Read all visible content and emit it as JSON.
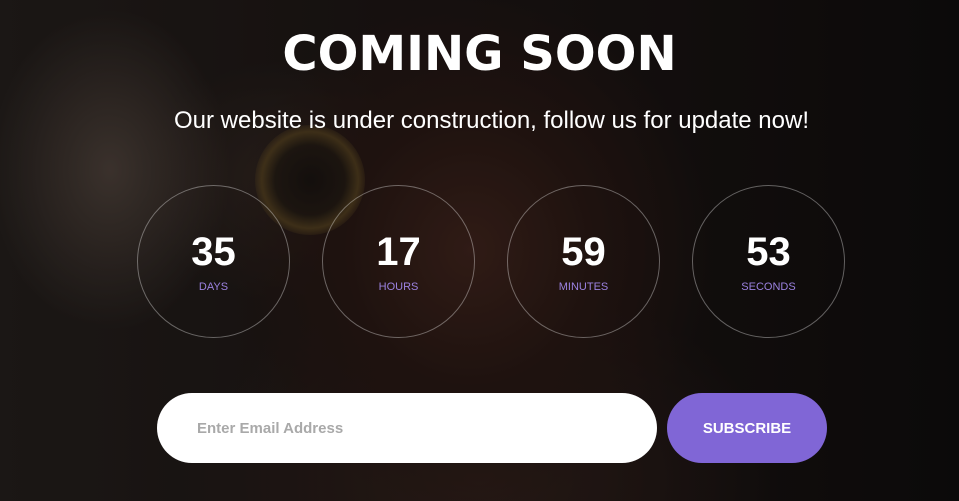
{
  "header": {
    "title": "COMING SOON",
    "subtitle": "Our website is under construction, follow us for update now!"
  },
  "countdown": [
    {
      "value": "35",
      "unit": "DAYS"
    },
    {
      "value": "17",
      "unit": "HOURS"
    },
    {
      "value": "59",
      "unit": "MINUTES"
    },
    {
      "value": "53",
      "unit": "SECONDS"
    }
  ],
  "subscribe_form": {
    "email_value": "",
    "email_placeholder": "Enter Email Address",
    "button_label": "SUBSCRIBE"
  },
  "colors": {
    "accent": "#8066d6",
    "unit_label": "#9b82e0",
    "text": "#ffffff",
    "input_bg": "#ffffff"
  }
}
